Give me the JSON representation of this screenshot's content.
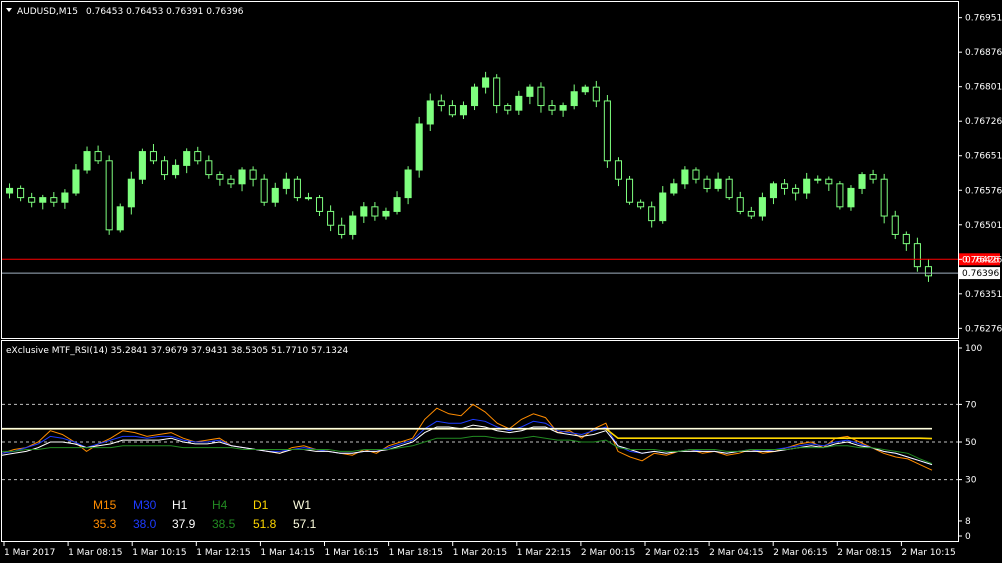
{
  "colors": {
    "background": "#000000",
    "frame": "#ffffff",
    "candle_bull": "#7fff7f",
    "candle_bear": "#000000",
    "candle_outline": "#7fff7f",
    "price_line_red": "#ff0000",
    "bid_line": "#a0b0c0",
    "level_line": "#c0c0c0",
    "m15": "#ff8c00",
    "m30": "#1e3cff",
    "h1": "#ffffff",
    "h4": "#228b22",
    "d1": "#ffd700",
    "w1": "#ffffe0"
  },
  "header": {
    "symbol_title": "AUDUSD,M15",
    "ohlc": "0.76453 0.76453 0.76391 0.76396"
  },
  "indicator": {
    "title": "eXclusive MTF_RSI(14) 35.2841 37.9679 37.9431 38.5305 51.7710 57.1324",
    "labels": [
      "M15",
      "M30",
      "H1",
      "H4",
      "D1",
      "W1"
    ],
    "values": [
      "35.3",
      "38.0",
      "37.9",
      "38.5",
      "51.8",
      "57.1"
    ]
  },
  "chart_data": [
    {
      "type": "candlestick",
      "title": "AUDUSD,M15",
      "y_ticks": [
        "0.76951",
        "0.76876",
        "0.76801",
        "0.76726",
        "0.76651",
        "0.76576",
        "0.76501",
        "0.76426",
        "0.76351",
        "0.76276"
      ],
      "ylim": [
        0.76255,
        0.76985
      ],
      "red_price_marker": "0.76426",
      "bid_marker": "0.76396",
      "x_ticks": [
        "1 Mar 2017",
        "1 Mar 08:15",
        "1 Mar 10:15",
        "1 Mar 12:15",
        "1 Mar 14:15",
        "1 Mar 16:15",
        "1 Mar 18:15",
        "1 Mar 20:15",
        "1 Mar 22:15",
        "2 Mar 00:15",
        "2 Mar 02:15",
        "2 Mar 04:15",
        "2 Mar 06:15",
        "2 Mar 08:15",
        "2 Mar 10:15"
      ],
      "close_path": [
        0.7658,
        0.7656,
        0.7655,
        0.7656,
        0.7655,
        0.7657,
        0.7662,
        0.7666,
        0.7664,
        0.7649,
        0.7654,
        0.766,
        0.7666,
        0.7664,
        0.7661,
        0.7663,
        0.7666,
        0.7664,
        0.7661,
        0.766,
        0.7659,
        0.7662,
        0.766,
        0.7655,
        0.7658,
        0.766,
        0.7656,
        0.7656,
        0.7653,
        0.765,
        0.7648,
        0.7652,
        0.7654,
        0.7652,
        0.7653,
        0.7656,
        0.7662,
        0.7672,
        0.7677,
        0.7676,
        0.7674,
        0.7676,
        0.768,
        0.7682,
        0.7676,
        0.7675,
        0.7678,
        0.768,
        0.7676,
        0.7675,
        0.7676,
        0.7679,
        0.768,
        0.7677,
        0.7664,
        0.766,
        0.7655,
        0.7654,
        0.7651,
        0.7657,
        0.7659,
        0.7662,
        0.766,
        0.7658,
        0.766,
        0.7656,
        0.7653,
        0.7652,
        0.7656,
        0.7659,
        0.7658,
        0.7657,
        0.766,
        0.766,
        0.7659,
        0.7654,
        0.7658,
        0.7661,
        0.766,
        0.7652,
        0.7648,
        0.7646,
        0.7641,
        0.7639
      ]
    },
    {
      "type": "line",
      "title": "eXclusive MTF_RSI(14)",
      "y_ticks": [
        "100",
        "70",
        "50",
        "30",
        "8",
        "0"
      ],
      "levels": [
        70,
        50,
        30
      ],
      "ylim": [
        0,
        100
      ],
      "series": [
        {
          "name": "M15",
          "values": [
            44,
            46,
            47,
            50,
            56,
            54,
            50,
            45,
            49,
            52,
            56,
            55,
            53,
            54,
            55,
            52,
            50,
            51,
            52,
            48,
            47,
            46,
            45,
            44,
            47,
            48,
            46,
            45,
            44,
            43,
            46,
            44,
            48,
            50,
            52,
            62,
            68,
            65,
            64,
            70,
            66,
            60,
            57,
            62,
            65,
            63,
            55,
            56,
            52,
            57,
            60,
            45,
            42,
            40,
            44,
            43,
            45,
            46,
            44,
            45,
            43,
            44,
            46,
            44,
            45,
            47,
            49,
            50,
            47,
            52,
            53,
            50,
            47,
            44,
            42,
            41,
            38,
            35
          ]
        },
        {
          "name": "M30",
          "values": [
            44,
            45,
            47,
            49,
            53,
            52,
            50,
            47,
            49,
            51,
            53,
            53,
            52,
            53,
            53,
            51,
            50,
            50,
            51,
            48,
            47,
            46,
            45,
            45,
            46,
            47,
            46,
            45,
            44,
            44,
            45,
            45,
            47,
            49,
            51,
            57,
            61,
            60,
            60,
            62,
            61,
            58,
            56,
            58,
            61,
            60,
            56,
            55,
            54,
            56,
            58,
            48,
            45,
            44,
            45,
            44,
            45,
            46,
            45,
            45,
            44,
            45,
            46,
            45,
            46,
            47,
            48,
            49,
            48,
            50,
            51,
            49,
            47,
            45,
            44,
            42,
            40,
            38
          ]
        },
        {
          "name": "H1",
          "values": [
            43,
            44,
            45,
            47,
            50,
            50,
            49,
            47,
            48,
            49,
            51,
            51,
            51,
            51,
            52,
            50,
            49,
            49,
            50,
            48,
            47,
            46,
            45,
            44,
            46,
            46,
            45,
            45,
            44,
            44,
            45,
            45,
            46,
            48,
            50,
            55,
            58,
            58,
            57,
            59,
            58,
            56,
            55,
            56,
            58,
            58,
            55,
            54,
            53,
            54,
            56,
            48,
            46,
            44,
            45,
            44,
            45,
            45,
            45,
            45,
            44,
            45,
            45,
            45,
            45,
            46,
            47,
            48,
            47,
            49,
            50,
            48,
            47,
            45,
            44,
            42,
            40,
            38
          ]
        },
        {
          "name": "H4",
          "values": [
            45,
            45,
            46,
            46,
            47,
            47,
            47,
            47,
            47,
            47,
            48,
            48,
            48,
            48,
            48,
            47,
            47,
            47,
            47,
            47,
            46,
            46,
            46,
            46,
            46,
            46,
            46,
            46,
            45,
            45,
            46,
            46,
            46,
            47,
            48,
            50,
            52,
            52,
            52,
            53,
            53,
            52,
            52,
            52,
            53,
            52,
            51,
            51,
            50,
            50,
            51,
            47,
            46,
            46,
            46,
            45,
            45,
            46,
            46,
            46,
            45,
            45,
            46,
            46,
            46,
            46,
            47,
            47,
            47,
            48,
            48,
            47,
            47,
            46,
            45,
            44,
            41,
            38.5
          ]
        },
        {
          "name": "D1",
          "values": [
            57,
            57,
            57,
            57,
            57,
            57,
            57,
            57,
            57,
            57,
            57,
            57,
            57,
            57,
            57,
            57,
            57,
            57,
            57,
            57,
            57,
            57,
            57,
            57,
            57,
            57,
            57,
            57,
            57,
            57,
            57,
            57,
            57,
            57,
            57,
            57,
            57,
            57,
            57,
            57,
            57,
            57,
            57,
            57,
            57,
            57,
            57,
            57,
            57,
            57,
            57,
            52,
            52,
            52,
            52,
            52,
            52,
            52,
            52,
            52,
            52,
            52,
            52,
            52,
            52,
            52,
            52,
            52,
            52,
            52,
            52,
            52,
            52,
            52,
            52,
            52,
            52,
            51.8
          ]
        },
        {
          "name": "W1",
          "values": [
            57.1,
            57.1
          ]
        }
      ]
    }
  ]
}
